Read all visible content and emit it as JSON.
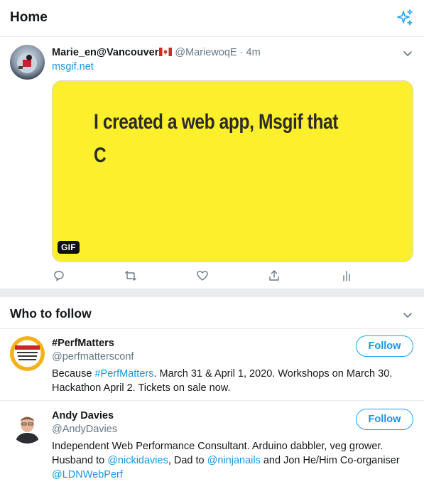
{
  "header": {
    "title": "Home",
    "sparkle_icon": "sparkle-icon"
  },
  "tweet": {
    "author_name": "Marie_en@Vancouver",
    "author_flag": "canada-flag-icon",
    "handle": "@MariewoqE",
    "separator": "·",
    "time": "4m",
    "link": "msgif.net",
    "media": {
      "text_line1": "I created a web app, Msgif that",
      "text_line2": "C",
      "badge": "GIF",
      "background": "#fcef2b"
    },
    "actions": [
      "reply-icon",
      "retweet-icon",
      "like-icon",
      "share-icon",
      "analytics-icon"
    ]
  },
  "who_to_follow": {
    "title": "Who to follow",
    "accounts": [
      {
        "name": "#PerfMatters",
        "handle": "@perfmattersconf",
        "follow_label": "Follow",
        "bio": {
          "part1": "Because ",
          "hashtag": "#PerfMatters",
          "part2": ". March 31 & April 1, 2020. Workshops on March 30. Hackathon April 2. Tickets on sale now."
        }
      },
      {
        "name": "Andy Davies",
        "handle": "@AndyDavies",
        "follow_label": "Follow",
        "bio": {
          "part1": "Independent Web Performance Consultant. Arduino dabbler, veg grower. Husband to ",
          "mention1": "@nickidavies",
          "part2": ", Dad to ",
          "mention2": "@ninjanails",
          "part3": " and Jon He/Him Co-organiser ",
          "mention3": "@LDNWebPerf"
        }
      }
    ]
  },
  "colors": {
    "accent": "#1da1f2",
    "link": "#1b95e0",
    "muted": "#657786",
    "divider": "#e6ecf0"
  }
}
